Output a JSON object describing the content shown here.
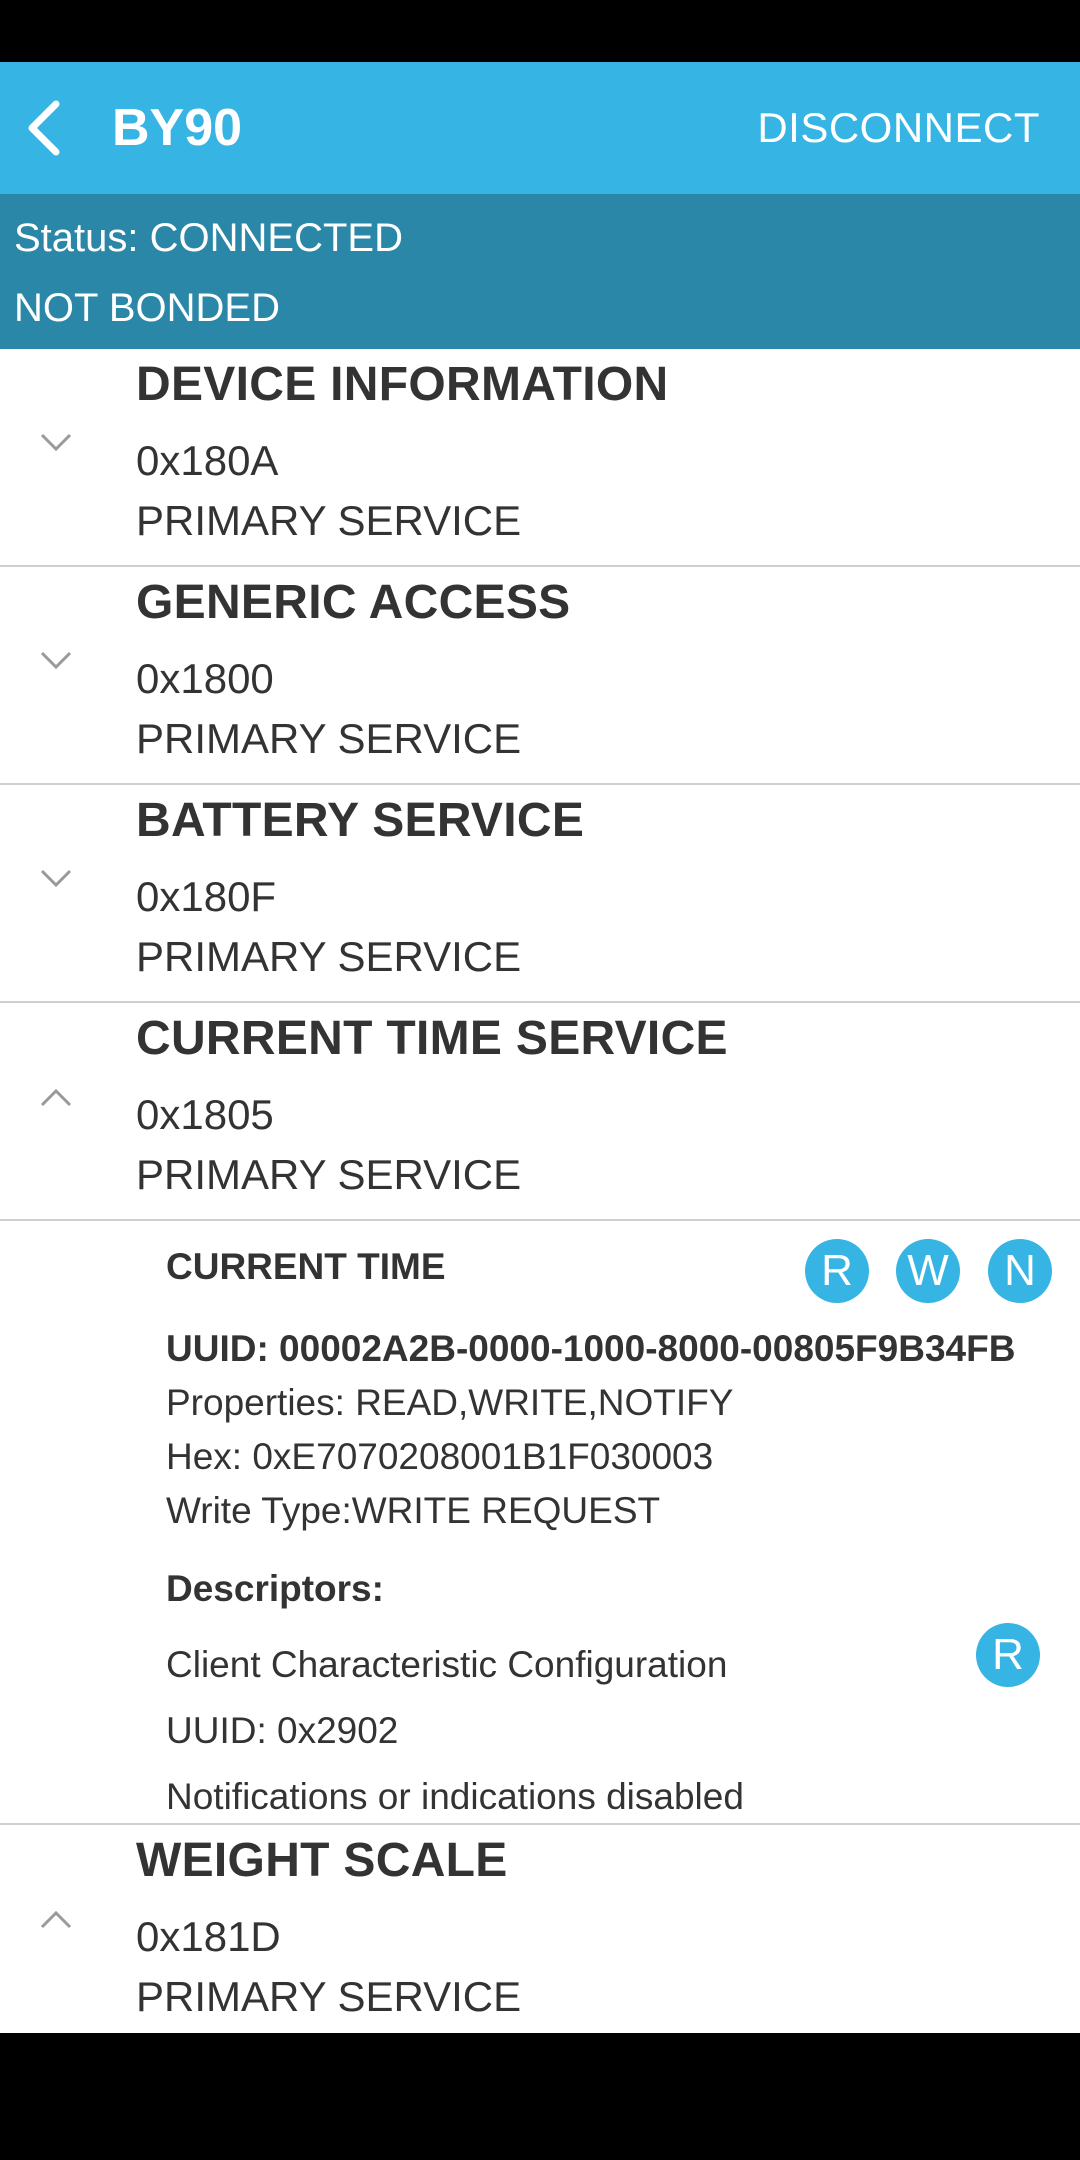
{
  "app_bar": {
    "title": "BY90",
    "disconnect_label": "DISCONNECT"
  },
  "connection": {
    "status": "Status: CONNECTED",
    "bond": "NOT BONDED"
  },
  "colors": {
    "app_bar": "#36b4e4",
    "status_bar": "#2a87a8",
    "property_badge": "#36b4e4"
  },
  "services": [
    {
      "name": "DEVICE INFORMATION",
      "uuid": "0x180A",
      "type": "PRIMARY SERVICE",
      "expanded": false
    },
    {
      "name": "GENERIC ACCESS",
      "uuid": "0x1800",
      "type": "PRIMARY SERVICE",
      "expanded": false
    },
    {
      "name": "BATTERY SERVICE",
      "uuid": "0x180F",
      "type": "PRIMARY SERVICE",
      "expanded": false
    },
    {
      "name": "CURRENT TIME SERVICE",
      "uuid": "0x1805",
      "type": "PRIMARY SERVICE",
      "expanded": true
    },
    {
      "name": "WEIGHT SCALE",
      "uuid": "0x181D",
      "type": "PRIMARY SERVICE",
      "expanded": true
    }
  ],
  "characteristic": {
    "name": "CURRENT TIME",
    "properties_badges": [
      "R",
      "W",
      "N"
    ],
    "uuid": "UUID: 00002A2B-0000-1000-8000-00805F9B34FB",
    "properties": "Properties: READ,WRITE,NOTIFY",
    "hex": "Hex: 0xE7070208001B1F030003",
    "write_type": "Write Type:WRITE REQUEST",
    "descriptors_heading": "Descriptors:",
    "descriptor": {
      "name": "Client Characteristic Configuration",
      "uuid": "UUID: 0x2902",
      "value": "Notifications or indications disabled",
      "badge": "R"
    }
  }
}
